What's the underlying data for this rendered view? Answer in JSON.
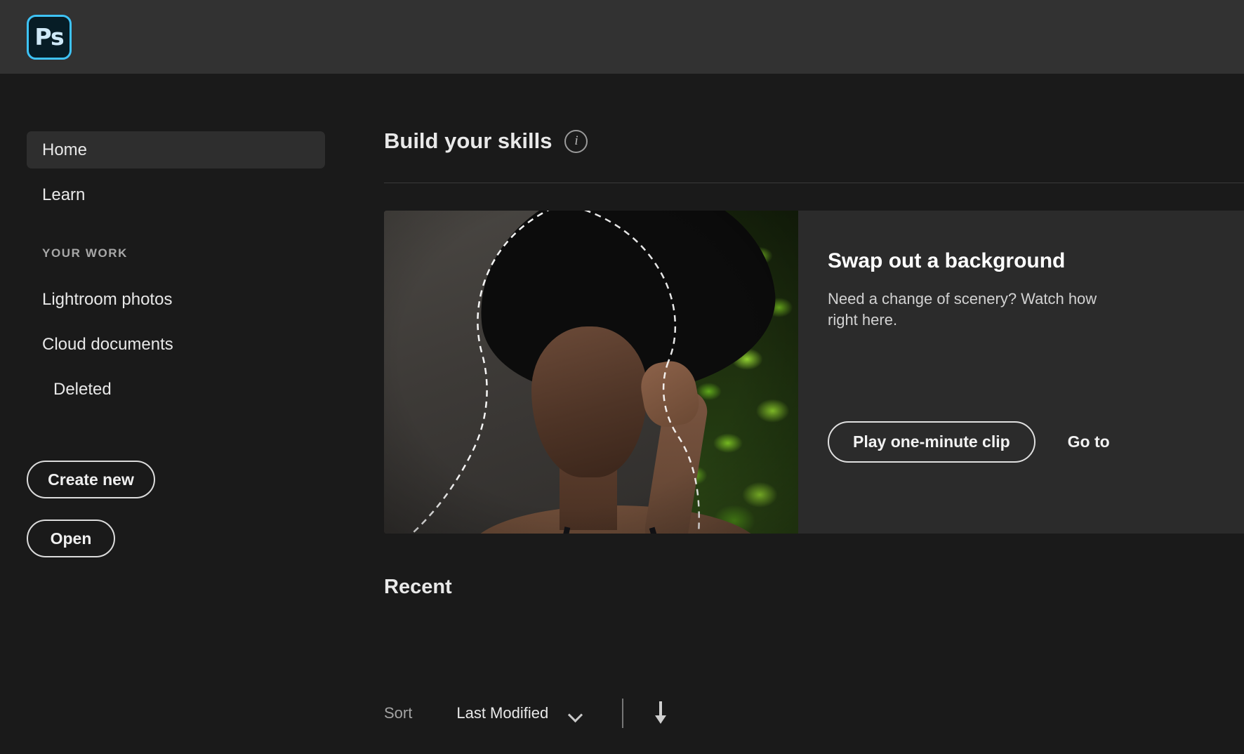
{
  "app": {
    "name": "Adobe Photoshop",
    "logo_text": "Ps",
    "accent_color": "#3ec3f7",
    "topbar_color": "#323232",
    "background_color": "#1a1a1a"
  },
  "sidebar": {
    "items": [
      {
        "label": "Home",
        "active": true
      },
      {
        "label": "Learn",
        "active": false
      }
    ],
    "section_label": "YOUR WORK",
    "work_items": [
      {
        "label": "Lightroom photos",
        "indent": false
      },
      {
        "label": "Cloud documents",
        "indent": false
      },
      {
        "label": "Deleted",
        "indent": true
      }
    ],
    "buttons": [
      {
        "label": "Create new"
      },
      {
        "label": "Open"
      }
    ]
  },
  "main": {
    "skills": {
      "title": "Build your skills",
      "info_icon": "info-icon",
      "card": {
        "title": "Swap out a background",
        "description": "Need a change of scenery? Watch how right here.",
        "primary_button": "Play one-minute clip",
        "secondary_link": "Go to"
      }
    },
    "recent": {
      "title": "Recent",
      "sort_label": "Sort",
      "sort_value": "Last Modified",
      "sort_chevron_icon": "chevron-down-icon",
      "sort_direction_icon": "arrow-down-icon"
    }
  }
}
